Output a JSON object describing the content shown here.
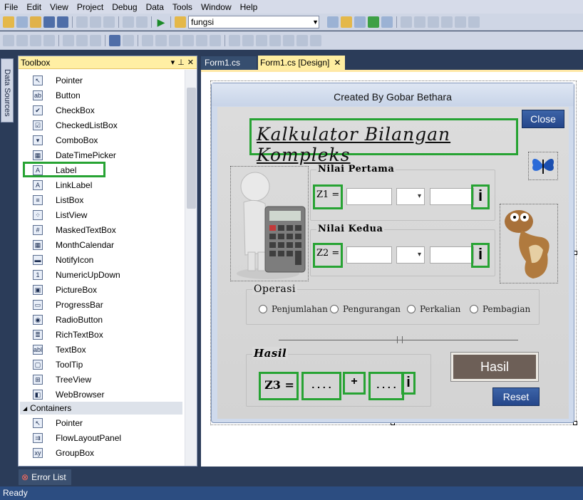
{
  "menu": [
    "File",
    "Edit",
    "View",
    "Project",
    "Debug",
    "Data",
    "Tools",
    "Window",
    "Help"
  ],
  "toolbar": {
    "config_value": "fungsi"
  },
  "side_tab": "Data Sources",
  "toolbox": {
    "title": "Toolbox",
    "items": [
      {
        "label": "Pointer",
        "icon": "pointer-icon",
        "glyph": "↖"
      },
      {
        "label": "Button",
        "icon": "button-icon",
        "glyph": "ab"
      },
      {
        "label": "CheckBox",
        "icon": "checkbox-icon",
        "glyph": "✔"
      },
      {
        "label": "CheckedListBox",
        "icon": "checkedlistbox-icon",
        "glyph": "☑"
      },
      {
        "label": "ComboBox",
        "icon": "combobox-icon",
        "glyph": "▾"
      },
      {
        "label": "DateTimePicker",
        "icon": "datetimepicker-icon",
        "glyph": "▦"
      },
      {
        "label": "Label",
        "icon": "label-icon",
        "glyph": "A"
      },
      {
        "label": "LinkLabel",
        "icon": "linklabel-icon",
        "glyph": "A"
      },
      {
        "label": "ListBox",
        "icon": "listbox-icon",
        "glyph": "≡"
      },
      {
        "label": "ListView",
        "icon": "listview-icon",
        "glyph": "⁘"
      },
      {
        "label": "MaskedTextBox",
        "icon": "maskedtextbox-icon",
        "glyph": "#"
      },
      {
        "label": "MonthCalendar",
        "icon": "monthcalendar-icon",
        "glyph": "▦"
      },
      {
        "label": "NotifyIcon",
        "icon": "notifyicon-icon",
        "glyph": "▬"
      },
      {
        "label": "NumericUpDown",
        "icon": "numericupdown-icon",
        "glyph": "1"
      },
      {
        "label": "PictureBox",
        "icon": "picturebox-icon",
        "glyph": "▣"
      },
      {
        "label": "ProgressBar",
        "icon": "progressbar-icon",
        "glyph": "▭"
      },
      {
        "label": "RadioButton",
        "icon": "radiobutton-icon",
        "glyph": "◉"
      },
      {
        "label": "RichTextBox",
        "icon": "richtextbox-icon",
        "glyph": "≣"
      },
      {
        "label": "TextBox",
        "icon": "textbox-icon",
        "glyph": "abl"
      },
      {
        "label": "ToolTip",
        "icon": "tooltip-icon",
        "glyph": "▢"
      },
      {
        "label": "TreeView",
        "icon": "treeview-icon",
        "glyph": "⊞"
      },
      {
        "label": "WebBrowser",
        "icon": "webbrowser-icon",
        "glyph": "◧"
      }
    ],
    "containers_header": "Containers",
    "container_items": [
      {
        "label": "Pointer",
        "icon": "pointer-icon",
        "glyph": "↖"
      },
      {
        "label": "FlowLayoutPanel",
        "icon": "flowlayoutpanel-icon",
        "glyph": "⇉"
      },
      {
        "label": "GroupBox",
        "icon": "groupbox-icon",
        "glyph": "xy"
      }
    ]
  },
  "tabs": {
    "code": "Form1.cs",
    "design": "Form1.cs [Design]"
  },
  "form": {
    "title": "Created By Gobar Bethara",
    "heading": "Kalkulator Bilangan Kompleks",
    "close_label": "Close",
    "group1_title": "Nilai Pertama",
    "z1_label": "Z1 =",
    "group2_title": "Nilai Kedua",
    "z2_label": "Z2 =",
    "imag_label": "i",
    "operasi_title": "Operasi",
    "operations": [
      "Penjumlahan",
      "Pengurangan",
      "Perkalian",
      "Pembagian"
    ],
    "hasil_title": "Hasil",
    "z3_label": "Z3 =",
    "result_real": ". . . .",
    "plus_sign": "+",
    "result_imag": ". . . .",
    "hasil_button": "Hasil",
    "reset_button": "Reset"
  },
  "bottom": {
    "error_list": "Error List",
    "status": "Ready"
  }
}
